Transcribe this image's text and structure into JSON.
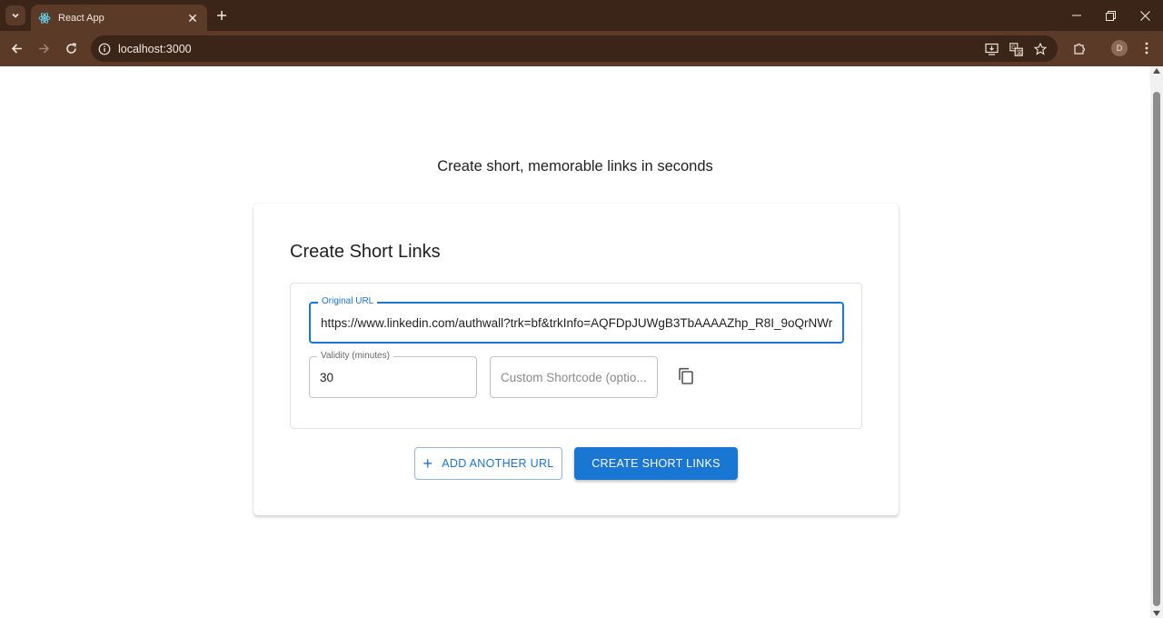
{
  "browser": {
    "tab_title": "React App",
    "address": "localhost:3000",
    "profile_initial": "D",
    "icons": {
      "tab_search": "chevron-down-icon",
      "tab_favicon": "react-logo-icon",
      "tab_close": "close-icon",
      "new_tab": "plus-icon",
      "back": "arrow-left-icon",
      "forward": "arrow-right-icon",
      "reload": "reload-icon",
      "site_info": "info-icon",
      "install": "install-app-icon",
      "translate": "translate-icon",
      "bookmark": "star-icon",
      "extensions": "puzzle-icon",
      "menu": "kebab-menu-icon",
      "minimize": "minimize-icon",
      "restore": "restore-icon",
      "close_window": "close-icon"
    },
    "colors": {
      "frame": "#3b2418",
      "toolbar": "#5b3a27"
    }
  },
  "page": {
    "subtitle": "Create short, memorable links in seconds",
    "card_title": "Create Short Links",
    "entry": {
      "url_label": "Original URL",
      "url_value": "https://www.linkedin.com/authwall?trk=bf&trkInfo=AQFDpJUWgB3TbAAAAZhp_R8I_9oQrNWr",
      "validity_label": "Validity (minutes)",
      "validity_value": "30",
      "shortcode_placeholder": "Custom Shortcode (optio..."
    },
    "buttons": {
      "add_another": "ADD ANOTHER URL",
      "add_icon": "+",
      "create": "CREATE SHORT LINKS"
    },
    "colors": {
      "primary": "#1976d2"
    }
  }
}
